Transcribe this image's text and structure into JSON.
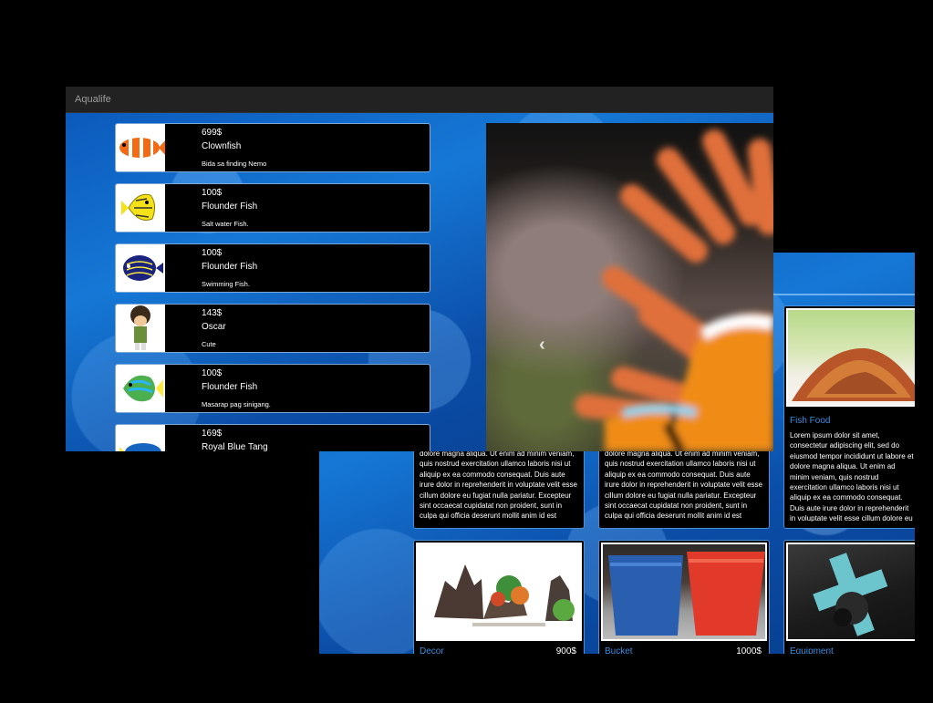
{
  "app": {
    "brand": "Aqualife"
  },
  "products": [
    {
      "price": "699$",
      "name": "Clownfish",
      "description": "Bida sa finding Nemo",
      "icon": "clownfish-icon"
    },
    {
      "price": "100$",
      "name": "Flounder Fish",
      "description": "Salt water Fish.",
      "icon": "yellow-fish-icon"
    },
    {
      "price": "100$",
      "name": "Flounder Fish",
      "description": "Swimming Fish.",
      "icon": "angelfish-icon"
    },
    {
      "price": "143$",
      "name": "Oscar",
      "description": "Cute",
      "icon": "cartoon-character-icon"
    },
    {
      "price": "100$",
      "name": "Flounder Fish",
      "description": "Masarap pag sinigang.",
      "icon": "green-fish-icon"
    },
    {
      "price": "169$",
      "name": "Royal Blue Tang",
      "description": "",
      "icon": "blue-tang-icon"
    }
  ],
  "carousel": {
    "prev_icon": "chevron-left-icon"
  },
  "shop": {
    "lorem_partial": "dolore magna aliqua. Ut enim ad minim veniam, quis nostrud exercitation ullamco laboris nisi ut aliquip ex ea commodo consequat. Duis aute irure dolor in reprehenderit in voluptate velit esse cillum dolore eu fugiat nulla pariatur. Excepteur sint occaecat cupidatat non proident, sunt in culpa qui officia deserunt mollit anim id est laborum.",
    "lorem_full": "Lorem ipsum dolor sit amet, consectetur adipiscing elit, sed do eiusmod tempor incididunt ut labore et dolore magna aliqua. Ut enim ad minim veniam, quis nostrud exercitation ullamco laboris nisi ut aliquip ex ea commodo consequat. Duis aute irure dolor in reprehenderit in voluptate velit esse cillum dolore eu fugiat nulla pariatur. Excepteur sint occaecat cupidatat non proident, sunt in culpa qui officia deserunt mollit anim id est laborum.",
    "fish_food": {
      "title": "Fish Food"
    },
    "decor": {
      "title": "Decor",
      "price": "900$"
    },
    "bucket": {
      "title": "Bucket",
      "price": "1000$"
    },
    "equipment": {
      "title": "Equipment"
    }
  }
}
